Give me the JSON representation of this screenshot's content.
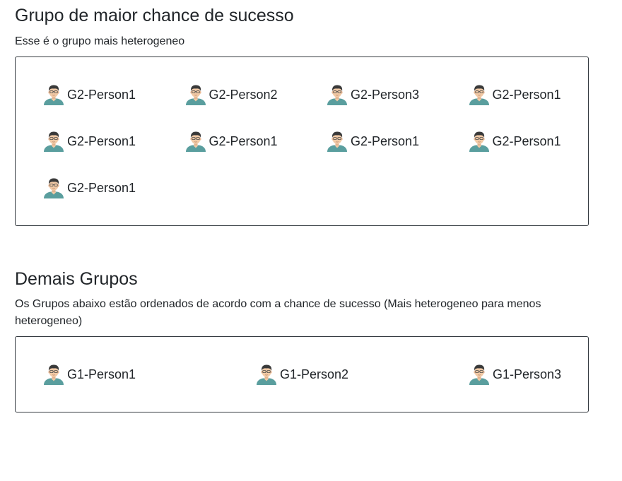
{
  "best_group": {
    "title": "Grupo de maior chance de sucesso",
    "description": "Esse é o grupo mais heterogeneo",
    "members": [
      {
        "name": "G2-Person1",
        "icon": "person-avatar-icon"
      },
      {
        "name": "G2-Person2",
        "icon": "person-avatar-icon"
      },
      {
        "name": "G2-Person3",
        "icon": "person-avatar-icon"
      },
      {
        "name": "G2-Person1",
        "icon": "person-avatar-icon"
      },
      {
        "name": "G2-Person1",
        "icon": "person-avatar-icon"
      },
      {
        "name": "G2-Person1",
        "icon": "person-avatar-icon"
      },
      {
        "name": "G2-Person1",
        "icon": "person-avatar-icon"
      },
      {
        "name": "G2-Person1",
        "icon": "person-avatar-icon"
      },
      {
        "name": "G2-Person1",
        "icon": "person-avatar-icon"
      }
    ]
  },
  "other_groups": {
    "title": "Demais Grupos",
    "description": "Os Grupos abaixo estão ordenados de acordo com a chance de sucesso (Mais heterogeneo para menos heterogeneo)",
    "groups": [
      {
        "members": [
          {
            "name": "G1-Person1",
            "icon": "person-avatar-icon"
          },
          {
            "name": "G1-Person2",
            "icon": "person-avatar-icon"
          },
          {
            "name": "G1-Person3",
            "icon": "person-avatar-icon"
          }
        ]
      }
    ]
  },
  "colors": {
    "text": "#212529",
    "border": "#343a40",
    "avatar_shirt": "#5a9e9e",
    "avatar_hair": "#3a3a3a",
    "avatar_skin": "#f1c9a5"
  }
}
